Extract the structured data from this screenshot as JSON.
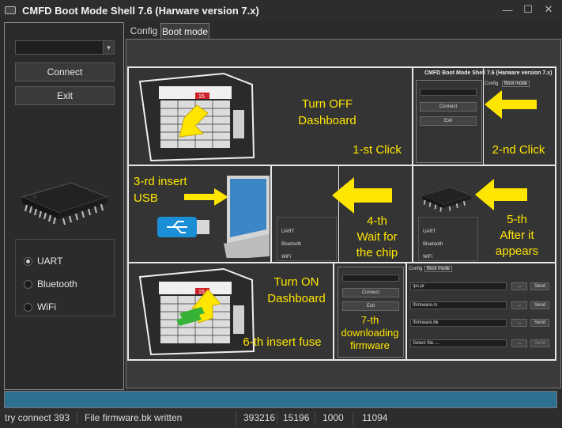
{
  "window": {
    "title": "CMFD Boot Mode Shell 7.6 (Harware version 7.x)",
    "minimize_icon": "minimize-icon",
    "maximize_icon": "maximize-icon",
    "close_icon": "close-icon"
  },
  "left_panel": {
    "port_combo_value": "",
    "connect_label": "Connect",
    "exit_label": "Exit",
    "chip_icon": "microchip-icon",
    "radios": [
      {
        "label": "UART",
        "checked": true
      },
      {
        "label": "Bluetooth",
        "checked": false
      },
      {
        "label": "WiFi",
        "checked": false
      }
    ]
  },
  "tabs": [
    {
      "label": "Config",
      "active": false
    },
    {
      "label": "Boot mode",
      "active": true
    }
  ],
  "instructions": {
    "step1a": "Turn OFF",
    "step1b": "Dashboard",
    "step1c": "1-st Click",
    "step2": "2-nd Click",
    "step3a": "3-rd insert",
    "step3b": "USB",
    "step4a": "4-th",
    "step4b": "Wait for",
    "step4c": "the chip",
    "step5a": "5-th",
    "step5b": "After it",
    "step5c": "appears",
    "step6a": "Turn ON",
    "step6b": "Dashboard",
    "step6c": "6-th insert fuse",
    "step7a": "7-th",
    "step7b": "downloading",
    "step7c": "firmware",
    "mini_title": "CMFD Boot Mode Shell 7.6 (Harware version 7.x)",
    "mini_tab_config": "Config",
    "mini_tab_boot": "Boot mode",
    "mini_connect": "Connect",
    "mini_exit": "Exit",
    "mini_uart": "UART",
    "mini_bluetooth": "Bluetooth",
    "mini_wifi": "WiFi",
    "fuse_highlight": "15",
    "mini_files": [
      {
        "name": "\\ps.pr",
        "btn": "...",
        "send": "Send"
      },
      {
        "name": "\\firmware.rs",
        "btn": "...",
        "send": "Send"
      },
      {
        "name": "\\firmware.bk",
        "btn": "...",
        "send": "Send"
      },
      {
        "name": "Select file.....",
        "btn": "...",
        "send": "Send"
      }
    ]
  },
  "colors": {
    "caption": "#ffe600",
    "arrow": "#ffe600",
    "fuse_red": "#d0202a",
    "progress": "#2e7090"
  },
  "status": {
    "left": "try connect 393",
    "message": "File firmware.bk written",
    "v1": "393216",
    "v2": "15196",
    "v3": "1000",
    "v4": "11094"
  }
}
